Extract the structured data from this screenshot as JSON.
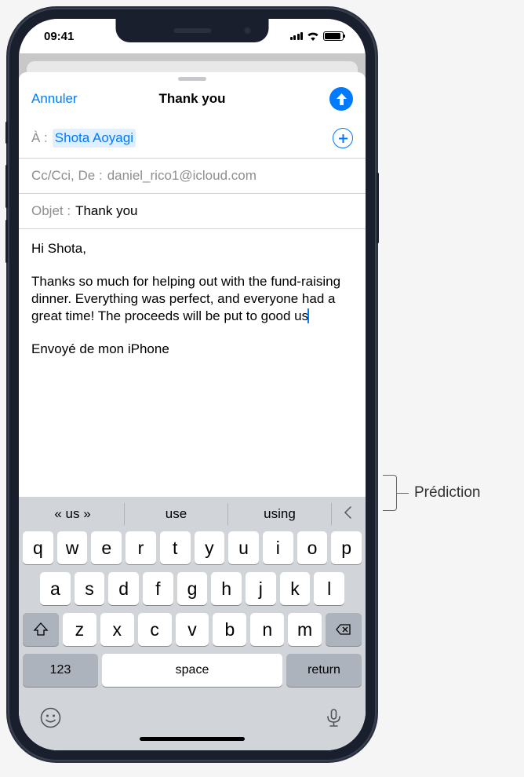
{
  "status": {
    "time": "09:41"
  },
  "nav": {
    "cancel": "Annuler",
    "title": "Thank you"
  },
  "fields": {
    "to_label": "À :",
    "to_value": "Shota Aoyagi",
    "cc_label": "Cc/Cci, De :",
    "cc_value": "daniel_rico1@icloud.com",
    "subject_label": "Objet :",
    "subject_value": "Thank you"
  },
  "body": {
    "greeting": "Hi Shota,",
    "para1": "Thanks so much for helping out with the fund-raising dinner. Everything was perfect, and everyone had a great time! The proceeds will be put to good us",
    "signature": "Envoyé de mon iPhone"
  },
  "predictions": {
    "p1": "« us »",
    "p2": "use",
    "p3": "using"
  },
  "keys": {
    "row1": [
      "q",
      "w",
      "e",
      "r",
      "t",
      "y",
      "u",
      "i",
      "o",
      "p"
    ],
    "row2": [
      "a",
      "s",
      "d",
      "f",
      "g",
      "h",
      "j",
      "k",
      "l"
    ],
    "row3": [
      "z",
      "x",
      "c",
      "v",
      "b",
      "n",
      "m"
    ],
    "numbers": "123",
    "space": "space",
    "return": "return"
  },
  "callout": {
    "label": "Prédiction"
  }
}
